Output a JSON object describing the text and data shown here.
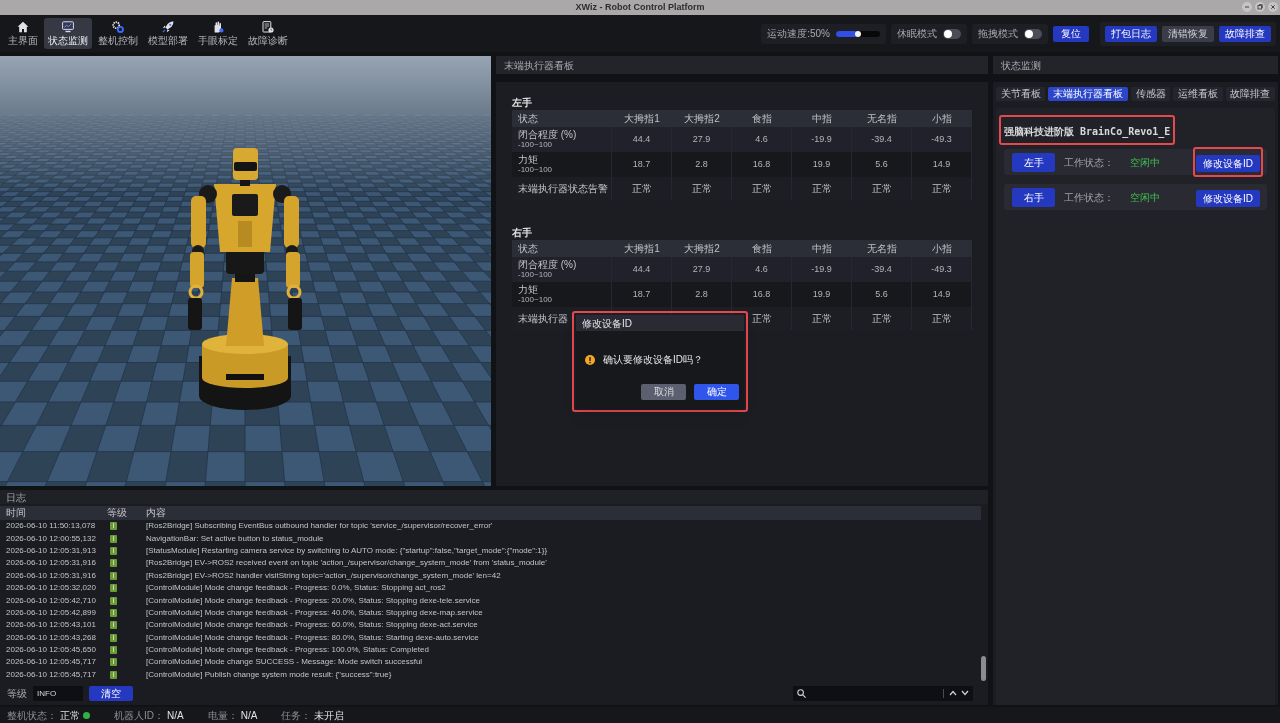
{
  "window": {
    "title": "XWiz - Robot Control Platform"
  },
  "nav": [
    {
      "label": "主界面",
      "selected": false
    },
    {
      "label": "状态监测",
      "selected": true
    },
    {
      "label": "整机控制",
      "selected": false
    },
    {
      "label": "模型部署",
      "selected": false
    },
    {
      "label": "手眼标定",
      "selected": false
    },
    {
      "label": "故障诊断",
      "selected": false
    }
  ],
  "toolbar": {
    "speed": {
      "label": "运动速度:50%",
      "level": 0.5
    },
    "toggles": [
      {
        "label": "休眠模式",
        "on": false
      },
      {
        "label": "拖拽模式",
        "on": false
      }
    ],
    "reset_button": "复位",
    "actions": [
      {
        "label": "打包日志",
        "kind": "primary"
      },
      {
        "label": "清错恢复",
        "kind": "secondary"
      },
      {
        "label": "故障排查",
        "kind": "primary"
      }
    ]
  },
  "end_effector_panel": {
    "title": "末端执行器看板",
    "hands": [
      {
        "title": "左手",
        "columns": [
          "状态",
          "大拇指1",
          "大拇指2",
          "食指",
          "中指",
          "无名指",
          "小指"
        ],
        "rows": [
          {
            "kind": "measure",
            "cells": [
              {
                "label": "闭合程度 (%)",
                "range": "-100~100"
              },
              {
                "value": "44.4"
              },
              {
                "value": "27.9"
              },
              {
                "value": "4.6"
              },
              {
                "value": "-19.9"
              },
              {
                "value": "-39.4"
              },
              {
                "value": "-49.3"
              }
            ]
          },
          {
            "kind": "measure",
            "cells": [
              {
                "label": "力矩",
                "range": "-100~100"
              },
              {
                "value": "18.7"
              },
              {
                "value": "2.8"
              },
              {
                "value": "16.8"
              },
              {
                "value": "19.9"
              },
              {
                "value": "5.6"
              },
              {
                "value": "14.9"
              }
            ]
          },
          {
            "kind": "status",
            "cells": [
              {
                "label": "末端执行器状态告警"
              },
              {
                "value": "正常"
              },
              {
                "value": "正常"
              },
              {
                "value": "正常"
              },
              {
                "value": "正常"
              },
              {
                "value": "正常"
              },
              {
                "value": "正常"
              }
            ]
          }
        ]
      },
      {
        "title": "右手",
        "columns": [
          "状态",
          "大拇指1",
          "大拇指2",
          "食指",
          "中指",
          "无名指",
          "小指"
        ],
        "rows": [
          {
            "kind": "measure",
            "cells": [
              {
                "label": "闭合程度 (%)",
                "range": "-100~100"
              },
              {
                "value": "44.4"
              },
              {
                "value": "27.9"
              },
              {
                "value": "4.6"
              },
              {
                "value": "-19.9"
              },
              {
                "value": "-39.4"
              },
              {
                "value": "-49.3"
              }
            ]
          },
          {
            "kind": "measure",
            "cells": [
              {
                "label": "力矩",
                "range": "-100~100"
              },
              {
                "value": "18.7"
              },
              {
                "value": "2.8"
              },
              {
                "value": "16.8"
              },
              {
                "value": "19.9"
              },
              {
                "value": "5.6"
              },
              {
                "value": "14.9"
              }
            ]
          },
          {
            "kind": "status",
            "cells": [
              {
                "label": "末端执行器"
              },
              {},
              {},
              {
                "value": "正常"
              },
              {
                "value": "正常"
              },
              {
                "value": "正常"
              },
              {
                "value": "正常"
              }
            ]
          }
        ]
      }
    ]
  },
  "dialog": {
    "title": "修改设备ID",
    "message": "确认要修改设备ID吗？",
    "highlighted": true,
    "buttons": [
      {
        "label": "取消",
        "kind": "secondary"
      },
      {
        "label": "确定",
        "kind": "primary"
      }
    ]
  },
  "status_panel": {
    "title": "状态监测",
    "tabs": [
      {
        "label": "关节看板",
        "selected": false
      },
      {
        "label": "末端执行器看板",
        "selected": true
      },
      {
        "label": "传感器",
        "selected": false
      },
      {
        "label": "运维看板",
        "selected": false
      },
      {
        "label": "故障排查",
        "selected": false
      }
    ],
    "device": {
      "title": "强脑科技进阶版 BrainCo_Revo1_E",
      "highlighted": true,
      "hands": [
        {
          "label": "左手",
          "status_label": "工作状态：",
          "status": "空闲中",
          "button": {
            "label": "修改设备ID",
            "highlighted": true
          }
        },
        {
          "label": "右手",
          "status_label": "工作状态：",
          "status": "空闲中",
          "button": {
            "label": "修改设备ID",
            "highlighted": false
          }
        }
      ]
    }
  },
  "log": {
    "title": "日志",
    "columns": [
      "时间",
      "等级",
      "内容"
    ],
    "entries": [
      {
        "time": "2026-06-10 11:50:13,078",
        "level": "I",
        "message": "[Ros2Bridge] Subscribing EventBus outbound handler for topic 'service_/supervisor/recover_error'"
      },
      {
        "time": "2026-06-10 12:00:55,132",
        "level": "I",
        "message": "NavigationBar: Set active button to status_module"
      },
      {
        "time": "2026-06-10 12:05:31,913",
        "level": "I",
        "message": "[StatusModule] Restarting camera service by switching to AUTO mode: {\"startup\":false,\"target_mode\":{\"mode\":1}}"
      },
      {
        "time": "2026-06-10 12:05:31,916",
        "level": "I",
        "message": "[Ros2Bridge] EV->ROS2 received event on topic 'action_/supervisor/change_system_mode' from 'status_module'"
      },
      {
        "time": "2026-06-10 12:05:31,916",
        "level": "I",
        "message": "[Ros2Bridge] EV->ROS2 handler visitString topic='action_/supervisor/change_system_mode' len=42"
      },
      {
        "time": "2026-06-10 12:05:32,020",
        "level": "I",
        "message": "[ControlModule] Mode change feedback - Progress: 0.0%, Status: Stopping act_ros2"
      },
      {
        "time": "2026-06-10 12:05:42,710",
        "level": "I",
        "message": "[ControlModule] Mode change feedback - Progress: 20.0%, Status: Stopping dexe-tele.service"
      },
      {
        "time": "2026-06-10 12:05:42,899",
        "level": "I",
        "message": "[ControlModule] Mode change feedback - Progress: 40.0%, Status: Stopping dexe-map.service"
      },
      {
        "time": "2026-06-10 12:05:43,101",
        "level": "I",
        "message": "[ControlModule] Mode change feedback - Progress: 60.0%, Status: Stopping dexe-act.service"
      },
      {
        "time": "2026-06-10 12:05:43,268",
        "level": "I",
        "message": "[ControlModule] Mode change feedback - Progress: 80.0%, Status: Starting dexe-auto.service"
      },
      {
        "time": "2026-06-10 12:05:45,650",
        "level": "I",
        "message": "[ControlModule] Mode change feedback - Progress: 100.0%, Status: Completed"
      },
      {
        "time": "2026-06-10 12:05:45,717",
        "level": "I",
        "message": "[ControlModule] Mode change SUCCESS - Message: Mode switch successful"
      },
      {
        "time": "2026-06-10 12:05:45,717",
        "level": "I",
        "message": "[ControlModule] Publish change system mode result: {\"success\":true}"
      }
    ],
    "level_label": "等级",
    "level_value": "INFO",
    "clear_button": "清空"
  },
  "status_bar": [
    {
      "kind": "indicator",
      "label": "整机状态：",
      "value": "正常"
    },
    {
      "kind": "text",
      "label": "机器人ID：",
      "value": "N/A"
    },
    {
      "kind": "text",
      "label": "电量：",
      "value": "N/A"
    },
    {
      "kind": "text",
      "label": "任务：",
      "value": "未开启"
    }
  ]
}
